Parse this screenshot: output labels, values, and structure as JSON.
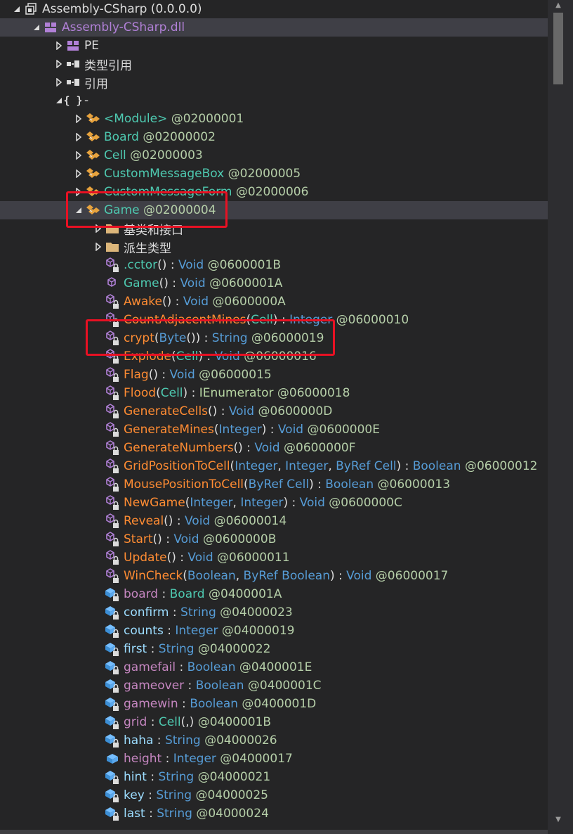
{
  "tree": {
    "rows": [
      {
        "indent": 0,
        "arrow": "expanded",
        "icon": "assembly-icon",
        "parts": [
          [
            "Assembly-CSharp (0.0.0.0)",
            "default"
          ]
        ]
      },
      {
        "indent": 1,
        "arrow": "expanded",
        "icon": "module-icon",
        "parts": [
          [
            "Assembly-CSharp.dll",
            "asm-dll"
          ]
        ],
        "selected": true
      },
      {
        "indent": 2,
        "arrow": "collapsed",
        "icon": "pe-icon",
        "parts": [
          [
            "PE",
            "default"
          ]
        ]
      },
      {
        "indent": 2,
        "arrow": "collapsed",
        "icon": "reference-icon",
        "parts": [
          [
            "类型引用",
            "default"
          ]
        ]
      },
      {
        "indent": 2,
        "arrow": "collapsed",
        "icon": "reference-icon",
        "parts": [
          [
            "引用",
            "default"
          ]
        ]
      },
      {
        "indent": 2,
        "arrow": "expanded",
        "icon": "namespace-icon",
        "parts": [
          [
            "-",
            "default"
          ]
        ]
      },
      {
        "indent": 3,
        "arrow": "collapsed",
        "icon": "class-icon",
        "parts": [
          [
            "<Module>",
            "name-type"
          ],
          [
            " @02000001",
            "token"
          ]
        ]
      },
      {
        "indent": 3,
        "arrow": "collapsed",
        "icon": "class-icon",
        "parts": [
          [
            "Board",
            "name-type"
          ],
          [
            " @02000002",
            "token"
          ]
        ]
      },
      {
        "indent": 3,
        "arrow": "collapsed",
        "icon": "class-icon",
        "parts": [
          [
            "Cell",
            "name-type"
          ],
          [
            " @02000003",
            "token"
          ]
        ]
      },
      {
        "indent": 3,
        "arrow": "collapsed",
        "icon": "class-icon",
        "parts": [
          [
            "CustomMessageBox",
            "name-type"
          ],
          [
            " @02000005",
            "token"
          ]
        ]
      },
      {
        "indent": 3,
        "arrow": "collapsed",
        "icon": "class-icon",
        "parts": [
          [
            "CustomMessageForm",
            "name-type"
          ],
          [
            " @02000006",
            "token"
          ]
        ]
      },
      {
        "indent": 3,
        "arrow": "expanded",
        "icon": "class-icon",
        "parts": [
          [
            "Game",
            "name-type"
          ],
          [
            " @02000004",
            "token"
          ]
        ],
        "selected": true
      },
      {
        "indent": 4,
        "arrow": "collapsed",
        "icon": "folder-icon",
        "parts": [
          [
            "基类和接口",
            "default"
          ]
        ]
      },
      {
        "indent": 4,
        "arrow": "collapsed",
        "icon": "folder-icon",
        "parts": [
          [
            "派生类型",
            "default"
          ]
        ]
      },
      {
        "indent": 4,
        "arrow": "none",
        "icon": "method-private-icon",
        "parts": [
          [
            ".cctor",
            "method"
          ],
          [
            "() : ",
            "punct"
          ],
          [
            "Void",
            "type"
          ],
          [
            " @0600001B",
            "token"
          ]
        ]
      },
      {
        "indent": 4,
        "arrow": "none",
        "icon": "method-icon",
        "parts": [
          [
            "Game",
            "method"
          ],
          [
            "() : ",
            "punct"
          ],
          [
            "Void",
            "type"
          ],
          [
            " @0600001A",
            "token"
          ]
        ]
      },
      {
        "indent": 4,
        "arrow": "none",
        "icon": "method-private-icon",
        "parts": [
          [
            "Awake",
            "method-priv"
          ],
          [
            "() : ",
            "punct"
          ],
          [
            "Void",
            "type"
          ],
          [
            " @0600000A",
            "token"
          ]
        ]
      },
      {
        "indent": 4,
        "arrow": "none",
        "icon": "method-private-icon",
        "parts": [
          [
            "CountAdjacentMines",
            "method-priv"
          ],
          [
            "(",
            "punct"
          ],
          [
            "Cell",
            "type2"
          ],
          [
            ") : ",
            "punct"
          ],
          [
            "Integer",
            "type"
          ],
          [
            " @06000010",
            "token"
          ]
        ]
      },
      {
        "indent": 4,
        "arrow": "none",
        "icon": "method-private-icon",
        "parts": [
          [
            "crypt",
            "method-priv"
          ],
          [
            "(",
            "punct"
          ],
          [
            "Byte",
            "type"
          ],
          [
            "()) : ",
            "punct"
          ],
          [
            "String",
            "type"
          ],
          [
            " @06000019",
            "token"
          ]
        ]
      },
      {
        "indent": 4,
        "arrow": "none",
        "icon": "method-private-icon",
        "parts": [
          [
            "Explode",
            "method-priv"
          ],
          [
            "(",
            "punct"
          ],
          [
            "Cell",
            "type2"
          ],
          [
            ") : ",
            "punct"
          ],
          [
            "Void",
            "type"
          ],
          [
            " @06000016",
            "token"
          ]
        ]
      },
      {
        "indent": 4,
        "arrow": "none",
        "icon": "method-private-icon",
        "parts": [
          [
            "Flag",
            "method-priv"
          ],
          [
            "() : ",
            "punct"
          ],
          [
            "Void",
            "type"
          ],
          [
            " @06000015",
            "token"
          ]
        ]
      },
      {
        "indent": 4,
        "arrow": "none",
        "icon": "method-private-icon",
        "parts": [
          [
            "Flood",
            "method-priv"
          ],
          [
            "(",
            "punct"
          ],
          [
            "Cell",
            "type2"
          ],
          [
            ") : ",
            "punct"
          ],
          [
            "IEnumerator",
            "iface"
          ],
          [
            " @06000018",
            "token"
          ]
        ]
      },
      {
        "indent": 4,
        "arrow": "none",
        "icon": "method-private-icon",
        "parts": [
          [
            "GenerateCells",
            "method-priv"
          ],
          [
            "() : ",
            "punct"
          ],
          [
            "Void",
            "type"
          ],
          [
            " @0600000D",
            "token"
          ]
        ]
      },
      {
        "indent": 4,
        "arrow": "none",
        "icon": "method-private-icon",
        "parts": [
          [
            "GenerateMines",
            "method-priv"
          ],
          [
            "(",
            "punct"
          ],
          [
            "Integer",
            "type"
          ],
          [
            ") : ",
            "punct"
          ],
          [
            "Void",
            "type"
          ],
          [
            " @0600000E",
            "token"
          ]
        ]
      },
      {
        "indent": 4,
        "arrow": "none",
        "icon": "method-private-icon",
        "parts": [
          [
            "GenerateNumbers",
            "method-priv"
          ],
          [
            "() : ",
            "punct"
          ],
          [
            "Void",
            "type"
          ],
          [
            " @0600000F",
            "token"
          ]
        ]
      },
      {
        "indent": 4,
        "arrow": "none",
        "icon": "method-private-icon",
        "parts": [
          [
            "GridPositionToCell",
            "method-priv"
          ],
          [
            "(",
            "punct"
          ],
          [
            "Integer",
            "type"
          ],
          [
            ", ",
            "punct"
          ],
          [
            "Integer",
            "type"
          ],
          [
            ", ",
            "punct"
          ],
          [
            "ByRef Cell",
            "type"
          ],
          [
            ") : ",
            "punct"
          ],
          [
            "Boolean",
            "type"
          ],
          [
            " @06000012",
            "token"
          ]
        ]
      },
      {
        "indent": 4,
        "arrow": "none",
        "icon": "method-private-icon",
        "parts": [
          [
            "MousePositionToCell",
            "method-priv"
          ],
          [
            "(",
            "punct"
          ],
          [
            "ByRef Cell",
            "type"
          ],
          [
            ") : ",
            "punct"
          ],
          [
            "Boolean",
            "type"
          ],
          [
            " @06000013",
            "token"
          ]
        ]
      },
      {
        "indent": 4,
        "arrow": "none",
        "icon": "method-private-icon",
        "parts": [
          [
            "NewGame",
            "method-priv"
          ],
          [
            "(",
            "punct"
          ],
          [
            "Integer",
            "type"
          ],
          [
            ", ",
            "punct"
          ],
          [
            "Integer",
            "type"
          ],
          [
            ") : ",
            "punct"
          ],
          [
            "Void",
            "type"
          ],
          [
            " @0600000C",
            "token"
          ]
        ]
      },
      {
        "indent": 4,
        "arrow": "none",
        "icon": "method-private-icon",
        "parts": [
          [
            "Reveal",
            "method-priv"
          ],
          [
            "() : ",
            "punct"
          ],
          [
            "Void",
            "type"
          ],
          [
            " @06000014",
            "token"
          ]
        ]
      },
      {
        "indent": 4,
        "arrow": "none",
        "icon": "method-private-icon",
        "parts": [
          [
            "Start",
            "method-priv"
          ],
          [
            "() : ",
            "punct"
          ],
          [
            "Void",
            "type"
          ],
          [
            " @0600000B",
            "token"
          ]
        ]
      },
      {
        "indent": 4,
        "arrow": "none",
        "icon": "method-private-icon",
        "parts": [
          [
            "Update",
            "method-priv"
          ],
          [
            "() : ",
            "punct"
          ],
          [
            "Void",
            "type"
          ],
          [
            " @06000011",
            "token"
          ]
        ]
      },
      {
        "indent": 4,
        "arrow": "none",
        "icon": "method-private-icon",
        "parts": [
          [
            "WinCheck",
            "method-priv"
          ],
          [
            "(",
            "punct"
          ],
          [
            "Boolean",
            "type"
          ],
          [
            ", ",
            "punct"
          ],
          [
            "ByRef Boolean",
            "type"
          ],
          [
            ") : ",
            "punct"
          ],
          [
            "Void",
            "type"
          ],
          [
            " @06000017",
            "token"
          ]
        ]
      },
      {
        "indent": 4,
        "arrow": "none",
        "icon": "field-private-icon",
        "parts": [
          [
            "board",
            "field-priv"
          ],
          [
            " : ",
            "punct"
          ],
          [
            "Board",
            "type2"
          ],
          [
            " @0400001A",
            "token"
          ]
        ]
      },
      {
        "indent": 4,
        "arrow": "none",
        "icon": "field-private-icon",
        "parts": [
          [
            "confirm",
            "field"
          ],
          [
            " : ",
            "punct"
          ],
          [
            "String",
            "type"
          ],
          [
            " @04000023",
            "token"
          ]
        ]
      },
      {
        "indent": 4,
        "arrow": "none",
        "icon": "field-private-icon",
        "parts": [
          [
            "counts",
            "field"
          ],
          [
            " : ",
            "punct"
          ],
          [
            "Integer",
            "type"
          ],
          [
            " @04000019",
            "token"
          ]
        ]
      },
      {
        "indent": 4,
        "arrow": "none",
        "icon": "field-private-icon",
        "parts": [
          [
            "first",
            "field"
          ],
          [
            " : ",
            "punct"
          ],
          [
            "String",
            "type"
          ],
          [
            " @04000022",
            "token"
          ]
        ]
      },
      {
        "indent": 4,
        "arrow": "none",
        "icon": "field-private-icon",
        "parts": [
          [
            "gamefail",
            "field-priv"
          ],
          [
            " : ",
            "punct"
          ],
          [
            "Boolean",
            "type"
          ],
          [
            " @0400001E",
            "token"
          ]
        ]
      },
      {
        "indent": 4,
        "arrow": "none",
        "icon": "field-private-icon",
        "parts": [
          [
            "gameover",
            "field-priv"
          ],
          [
            " : ",
            "punct"
          ],
          [
            "Boolean",
            "type"
          ],
          [
            " @0400001C",
            "token"
          ]
        ]
      },
      {
        "indent": 4,
        "arrow": "none",
        "icon": "field-private-icon",
        "parts": [
          [
            "gamewin",
            "field-priv"
          ],
          [
            " : ",
            "punct"
          ],
          [
            "Boolean",
            "type"
          ],
          [
            " @0400001D",
            "token"
          ]
        ]
      },
      {
        "indent": 4,
        "arrow": "none",
        "icon": "field-private-icon",
        "parts": [
          [
            "grid",
            "field-priv"
          ],
          [
            " : ",
            "punct"
          ],
          [
            "Cell",
            "type2"
          ],
          [
            "(,)",
            "punct"
          ],
          [
            " @0400001B",
            "token"
          ]
        ]
      },
      {
        "indent": 4,
        "arrow": "none",
        "icon": "field-private-icon",
        "parts": [
          [
            "haha",
            "field"
          ],
          [
            " : ",
            "punct"
          ],
          [
            "String",
            "type"
          ],
          [
            " @04000026",
            "token"
          ]
        ]
      },
      {
        "indent": 4,
        "arrow": "none",
        "icon": "field-icon",
        "parts": [
          [
            "height",
            "field-priv"
          ],
          [
            " : ",
            "punct"
          ],
          [
            "Integer",
            "type"
          ],
          [
            " @04000017",
            "token"
          ]
        ]
      },
      {
        "indent": 4,
        "arrow": "none",
        "icon": "field-private-icon",
        "parts": [
          [
            "hint",
            "field"
          ],
          [
            " : ",
            "punct"
          ],
          [
            "String",
            "type"
          ],
          [
            " @04000021",
            "token"
          ]
        ]
      },
      {
        "indent": 4,
        "arrow": "none",
        "icon": "field-private-icon",
        "parts": [
          [
            "key",
            "field"
          ],
          [
            " : ",
            "punct"
          ],
          [
            "String",
            "type"
          ],
          [
            " @04000025",
            "token"
          ]
        ]
      },
      {
        "indent": 4,
        "arrow": "none",
        "icon": "field-private-icon",
        "parts": [
          [
            "last",
            "field"
          ],
          [
            " : ",
            "punct"
          ],
          [
            "String",
            "type"
          ],
          [
            " @04000024",
            "token"
          ]
        ]
      }
    ]
  },
  "highlights": [
    {
      "row": "Game"
    },
    {
      "row": "crypt"
    }
  ],
  "colors": {
    "background": "#252526",
    "selection": "#3f3f46",
    "highlight": "#e81123"
  }
}
